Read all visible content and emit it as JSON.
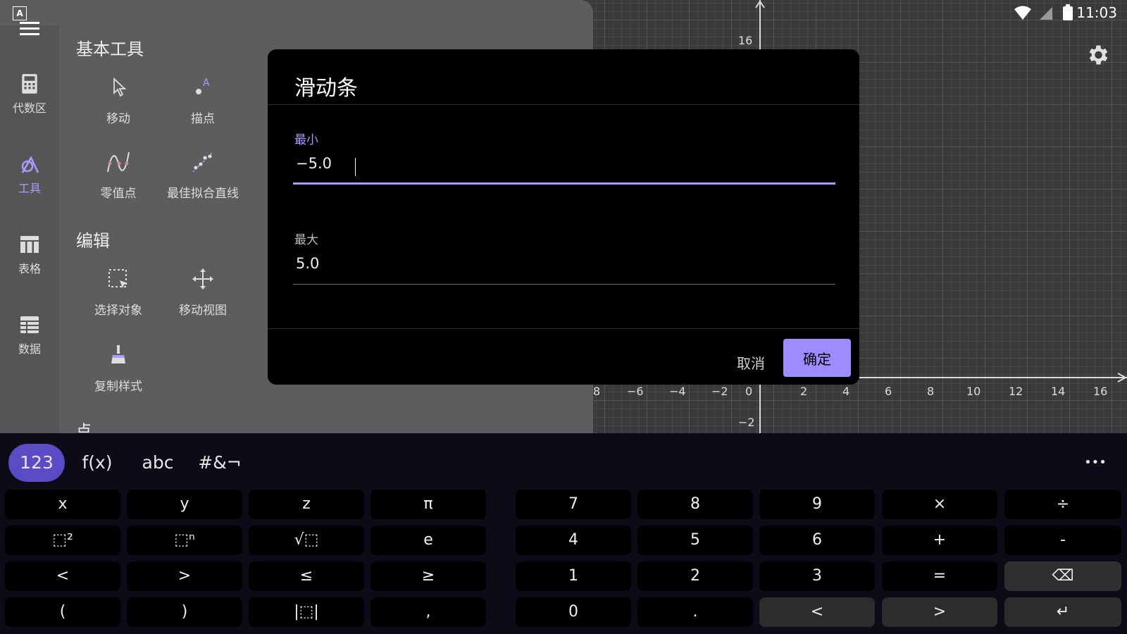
{
  "status_bar": {
    "time": "11:03",
    "app_icon_letter": "A"
  },
  "graph": {
    "x_ticks": [
      "8",
      "−6",
      "−4",
      "−2",
      "0",
      "2",
      "4",
      "6",
      "8",
      "10",
      "12",
      "14",
      "16"
    ],
    "y_ticks": [
      "16",
      "−2"
    ]
  },
  "rail": {
    "items": [
      {
        "label": "代数区",
        "icon": "calculator-icon"
      },
      {
        "label": "工具",
        "icon": "geometry-tools-icon"
      },
      {
        "label": "表格",
        "icon": "table-icon"
      },
      {
        "label": "数据",
        "icon": "spreadsheet-icon"
      }
    ]
  },
  "tools": {
    "basic_title": "基本工具",
    "basic": [
      {
        "label": "移动",
        "icon": "cursor-icon"
      },
      {
        "label": "描点",
        "icon": "point-icon"
      },
      {
        "label": "零值点",
        "icon": "roots-icon"
      },
      {
        "label": "最佳拟合直线",
        "icon": "best-fit-line-icon"
      }
    ],
    "edit_title": "编辑",
    "edit": [
      {
        "label": "选择对象",
        "icon": "select-object-icon"
      },
      {
        "label": "移动视图",
        "icon": "move-view-icon"
      },
      {
        "label": "复制样式",
        "icon": "copy-style-icon"
      }
    ],
    "next_section": "点"
  },
  "dialog": {
    "title": "滑动条",
    "min_label": "最小",
    "min_value": "−5.0",
    "max_label": "最大",
    "max_value": "5.0",
    "cancel": "取消",
    "ok": "确定"
  },
  "keyboard": {
    "tabs": [
      "123",
      "f(x)",
      "abc",
      "#&¬"
    ],
    "more": "•••",
    "left_rows": [
      [
        "x",
        "y",
        "z",
        "π"
      ],
      [
        "⬚²",
        "⬚ⁿ",
        "√⬚",
        "e"
      ],
      [
        "<",
        ">",
        "≤",
        "≥"
      ],
      [
        "(",
        ")",
        "|⬚|",
        ","
      ]
    ],
    "right_rows": [
      [
        "7",
        "8",
        "9",
        "×",
        "÷"
      ],
      [
        "4",
        "5",
        "6",
        "+",
        "-"
      ],
      [
        "1",
        "2",
        "3",
        "=",
        "⌫"
      ],
      [
        "0",
        ".",
        "<",
        ">",
        "↵"
      ]
    ]
  },
  "colors": {
    "accent": "#9d8cff",
    "tab_active": "#5b4bc4"
  }
}
